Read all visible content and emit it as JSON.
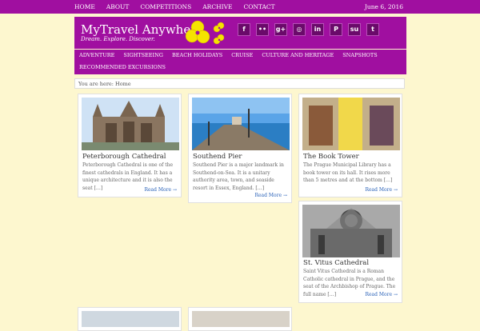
{
  "topnav": {
    "items": [
      "HOME",
      "ABOUT",
      "COMPETITIONS",
      "ARCHIVE",
      "CONTACT"
    ],
    "date": "June 6, 2016"
  },
  "site": {
    "title": "MyTravel Anywhere",
    "tagline": "Dream. Explore. Discover."
  },
  "social": {
    "icons": [
      "facebook-icon",
      "flickr-icon",
      "google-plus-icon",
      "instagram-icon",
      "linkedin-icon",
      "pinterest-icon",
      "stumbleupon-icon",
      "twitter-icon"
    ],
    "glyphs": [
      "f",
      "••",
      "g+",
      "◎",
      "in",
      "P",
      "su",
      "t"
    ]
  },
  "mainnav": {
    "items": [
      "ADVENTURE",
      "SIGHTSEEING",
      "BEACH HOLIDAYS",
      "CRUISE",
      "CULTURE AND HERITAGE",
      "SNAPSHOTS",
      "RECOMMENDED EXCURSIONS"
    ]
  },
  "breadcrumb": "You are here: Home",
  "posts": [
    {
      "title": "Peterborough Cathedral",
      "excerpt": "Peterborough Cathedral is one of the finest cathedrals in England. It has a unique architecture and it is also the seat […]",
      "more": "Read More →"
    },
    {
      "title": "Southend Pier",
      "excerpt": "Southend Pier is a major landmark in Southend-on-Sea. It is a unitary authority area, town, and seaside resort in Essex, England. […]",
      "more": "Read More →"
    },
    {
      "title": "The Book Tower",
      "excerpt": "The Prague Municipal Library has a book tower on its hall. It rises more than 5 metres and at the bottom […]",
      "more": "Read More →"
    },
    {
      "title": "St. Vitus Cathedral",
      "excerpt": "Saint Vitus Cathedral is a Roman Catholic cathedral in Prague, and the seat of the Archbishop of Prague. The full name […]",
      "more": "Read More →"
    }
  ],
  "colors": {
    "brand": "#a00fa0",
    "background": "#fdf7cf",
    "link": "#2a62b8"
  }
}
